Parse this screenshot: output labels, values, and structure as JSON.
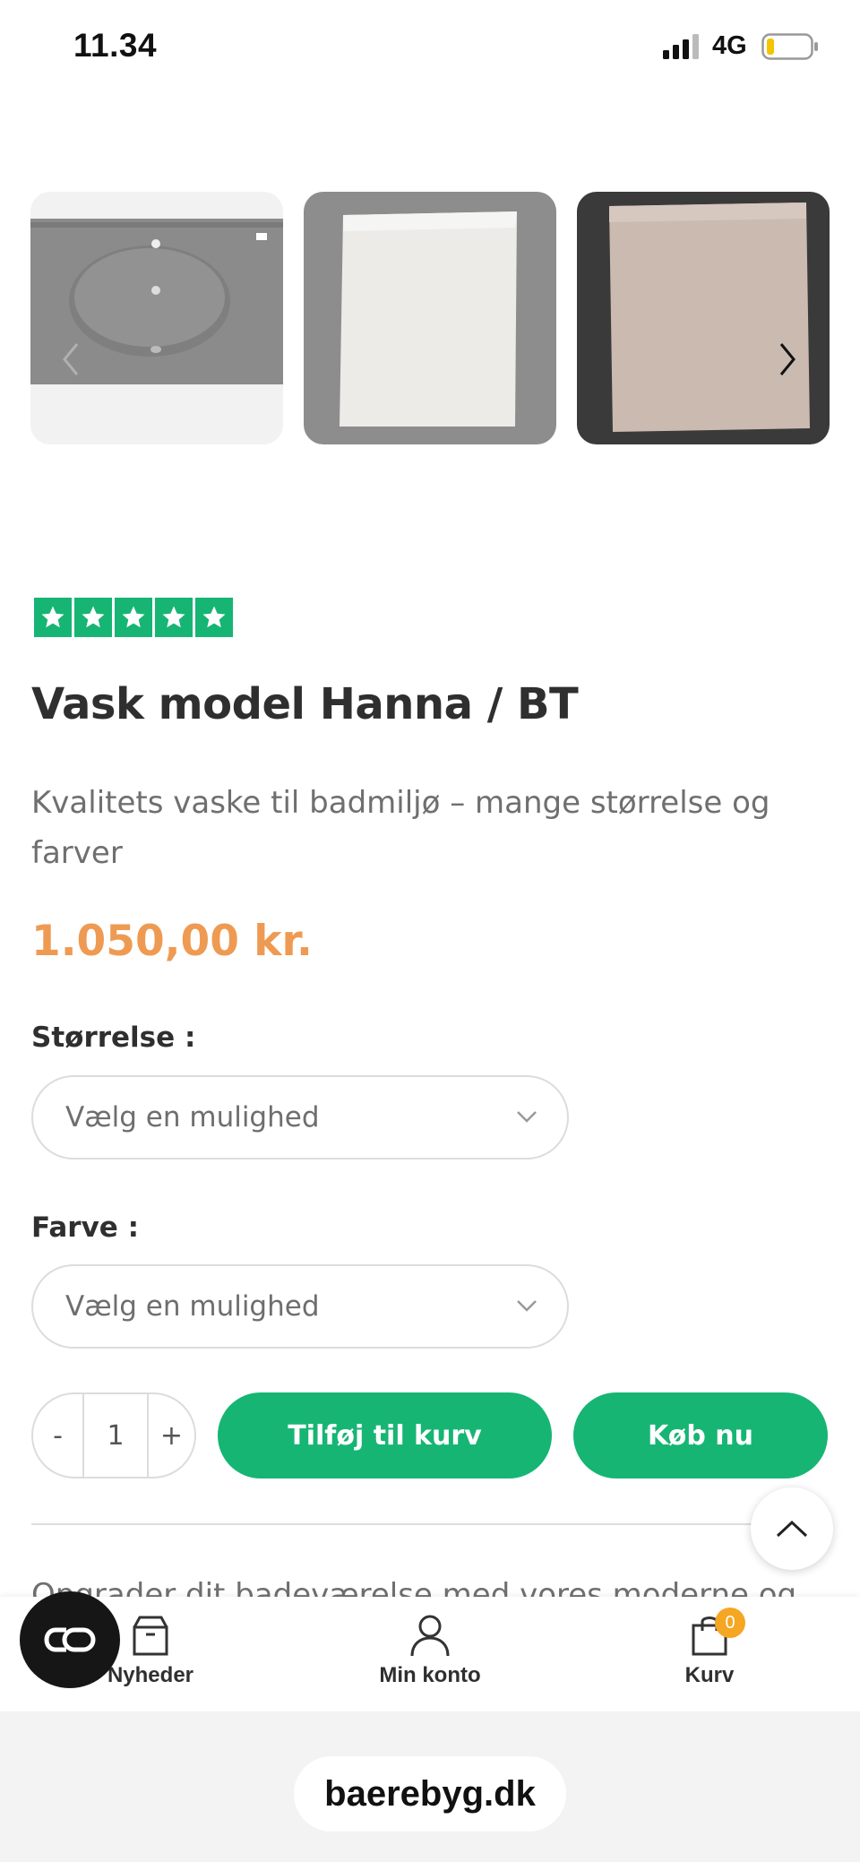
{
  "status_bar": {
    "time": "11.34",
    "network": "4G",
    "battery_level": 0.15
  },
  "gallery": {
    "images": [
      {
        "name": "sink-top-grey",
        "color": "#8a8a8a"
      },
      {
        "name": "panel-white",
        "color": "#eceae6"
      },
      {
        "name": "panel-granite",
        "color": "#cbbab0"
      }
    ]
  },
  "rating": {
    "stars": 5,
    "color": "#16b574"
  },
  "product": {
    "title": "Vask model Hanna / BT",
    "subtitle": "Kvalitets vaske til badmiljø – mange størrelse og farver",
    "price": "1.050,00 kr.",
    "price_color": "#ef9a52"
  },
  "options": {
    "size_label": "Størrelse :",
    "size_placeholder": "Vælg en mulighed",
    "color_label": "Farve :",
    "color_placeholder": "Vælg en mulighed"
  },
  "cart": {
    "qty_minus": "-",
    "qty_value": "1",
    "qty_plus": "+",
    "add_to_cart": "Tilføj til kurv",
    "buy_now": "Køb nu",
    "accent": "#16b574"
  },
  "description_peek": "Opgrader dit badeværelse med vores moderne og",
  "bottom_nav": {
    "items": [
      {
        "label": "Nyheder",
        "icon": "box-icon"
      },
      {
        "label": "Min konto",
        "icon": "user-icon"
      },
      {
        "label": "Kurv",
        "icon": "bag-icon",
        "badge": "0"
      }
    ]
  },
  "browser": {
    "url": "baerebyg.dk"
  }
}
